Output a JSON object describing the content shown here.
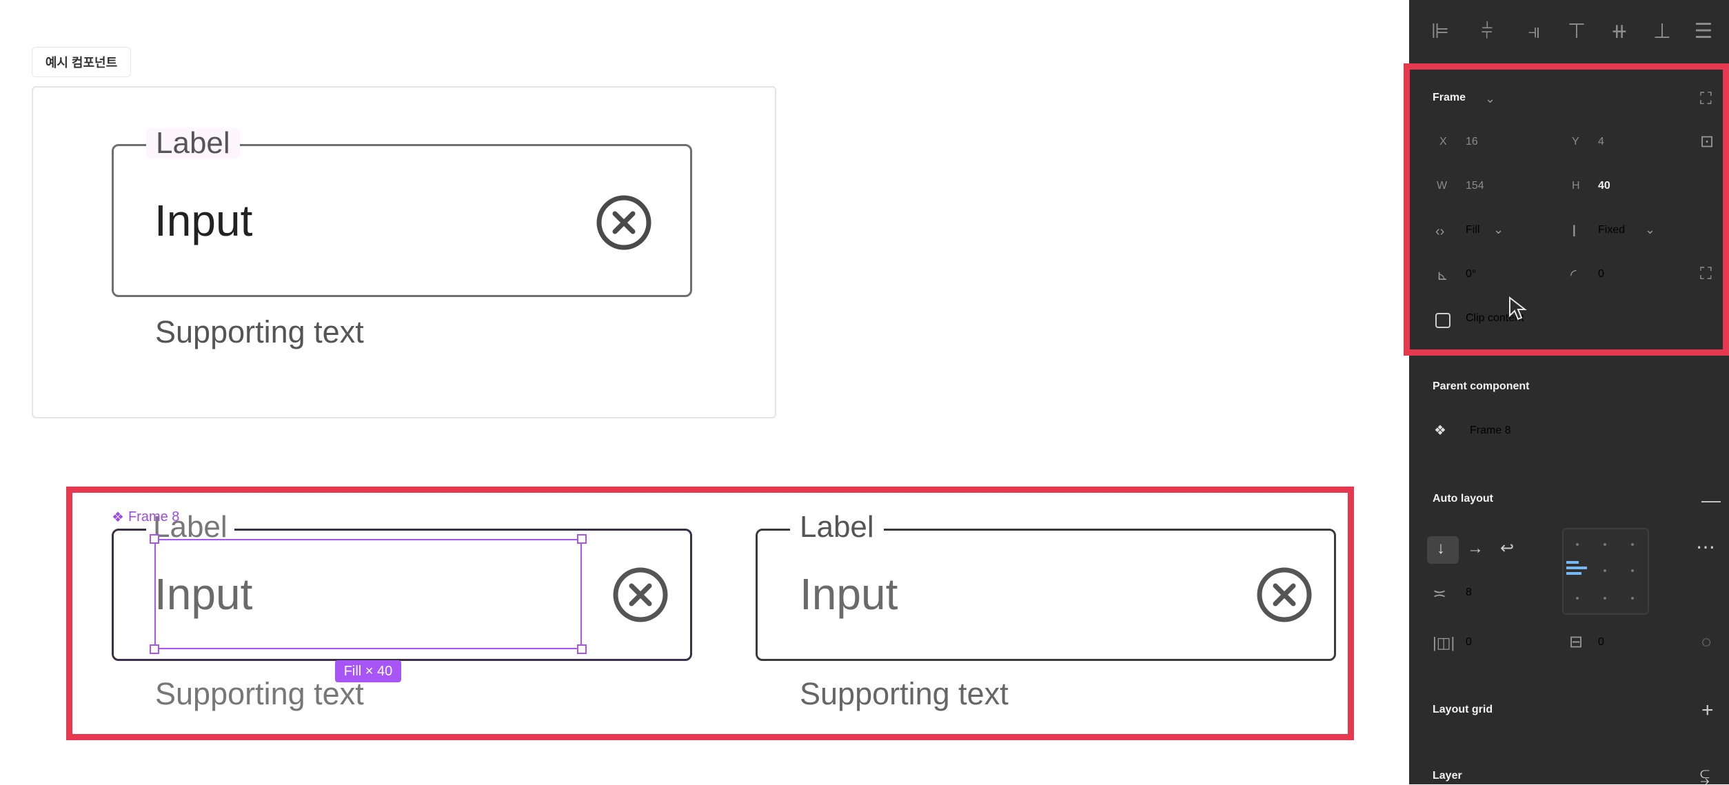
{
  "canvas": {
    "frame_name": "예시 컴포넌트",
    "example_field": {
      "label": "Label",
      "input": "Input",
      "supporting": "Supporting text"
    },
    "selected_field": {
      "frame_tag": "Frame 8",
      "label": "Label",
      "input": "Input",
      "supporting": "Supporting text",
      "size_badge": "Fill × 40"
    },
    "right_field": {
      "label": "Label",
      "input": "Input",
      "supporting": "Supporting text"
    }
  },
  "panel": {
    "frame_header": "Frame",
    "x_label": "X",
    "x_value": "16",
    "y_label": "Y",
    "y_value": "4",
    "w_label": "W",
    "w_value": "154",
    "h_label": "H",
    "h_value": "40",
    "width_mode": "Fill",
    "height_mode": "Fixed",
    "rotation": "0°",
    "radius": "0",
    "clip_content": "Clip content",
    "parent_component_title": "Parent component",
    "parent_component_name": "Frame 8",
    "auto_layout_title": "Auto layout",
    "gap": "8",
    "padding_h": "0",
    "padding_v": "0",
    "layout_grid_title": "Layout grid",
    "layer_title": "Layer"
  },
  "colors": {
    "highlight": "#e6394f",
    "selection": "#a855f7",
    "panel_bg": "#2c2c2c"
  }
}
